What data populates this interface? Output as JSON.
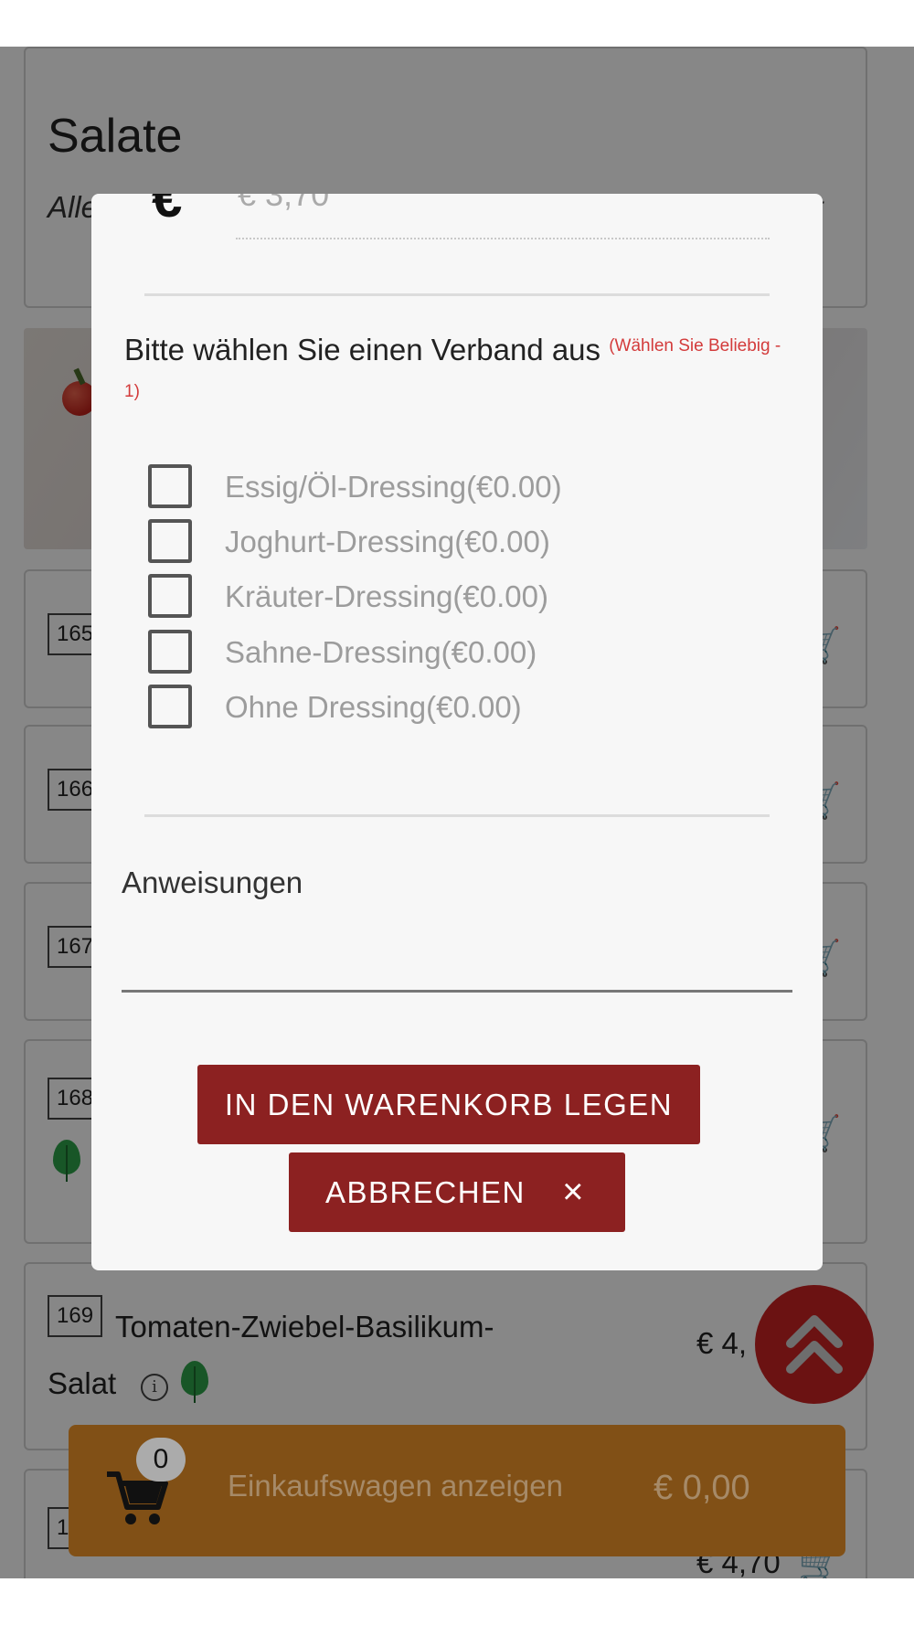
{
  "category": {
    "title": "Salate",
    "description": "Alle Salate werden mit einem Dressing nach Wahl serviert"
  },
  "menu_items": [
    {
      "number": "165"
    },
    {
      "number": "166"
    },
    {
      "number": "167"
    },
    {
      "number": "168"
    },
    {
      "number": "169",
      "name_line1": "Tomaten-Zwiebel-Basilikum-",
      "name_line2": "Salat",
      "price": "€ 4,"
    },
    {
      "number": "1",
      "price": "€ 4,70"
    }
  ],
  "modal": {
    "prev_price": "€ 3,70",
    "group_title": "Bitte wählen Sie einen Verband aus",
    "group_requirement": "(Wählen Sie Beliebig - 1)",
    "options": [
      {
        "label": "Essig/Öl-Dressing(€0.00)",
        "checked": false
      },
      {
        "label": "Joghurt-Dressing(€0.00)",
        "checked": false
      },
      {
        "label": "Kräuter-Dressing(€0.00)",
        "checked": false
      },
      {
        "label": "Sahne-Dressing(€0.00)",
        "checked": false
      },
      {
        "label": "Ohne Dressing(€0.00)",
        "checked": false
      }
    ],
    "instructions_label": "Anweisungen",
    "instructions_value": "",
    "add_button": "IN DEN WARENKORB LEGEN",
    "cancel_button": "ABBRECHEN",
    "cancel_icon": "×"
  },
  "cart": {
    "count": "0",
    "label": "Einkaufswagen anzeigen",
    "total": "€ 0,00"
  },
  "colors": {
    "primary": "#8c2121",
    "cart_bar": "#815016",
    "required_text": "#d33b3b",
    "leaf_icon": "#2fa34a"
  }
}
